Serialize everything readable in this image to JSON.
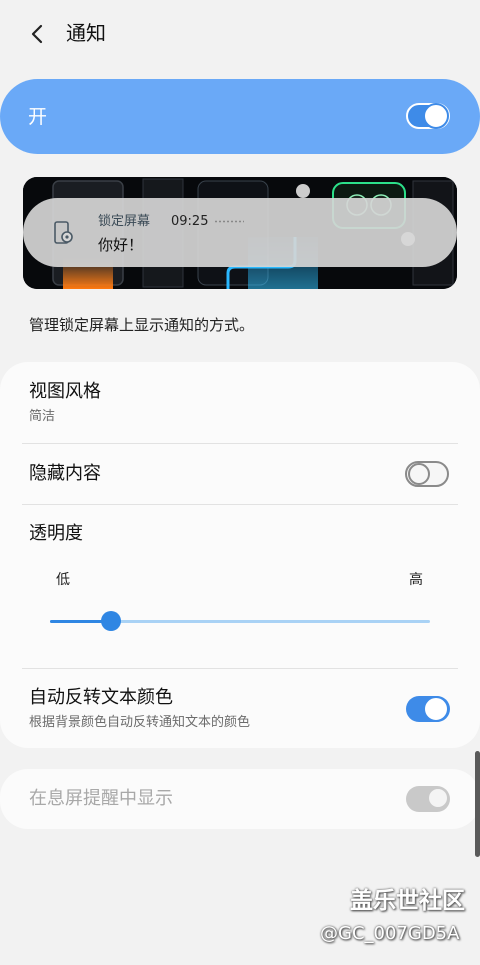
{
  "header": {
    "title": "通知",
    "back_icon": "chevron-left-icon"
  },
  "master": {
    "label": "开",
    "enabled": true
  },
  "preview": {
    "app_name": "锁定屏幕",
    "time": "09:25",
    "message": "你好！",
    "icon": "lockscreen-settings-icon"
  },
  "description": "管理锁定屏幕上显示通知的方式。",
  "settings": {
    "view_style": {
      "title": "视图风格",
      "value": "简洁"
    },
    "hide_content": {
      "title": "隐藏内容",
      "enabled": false
    },
    "transparency": {
      "title": "透明度",
      "low_label": "低",
      "high_label": "高",
      "value": 0.16
    },
    "auto_invert": {
      "title": "自动反转文本颜色",
      "subtitle": "根据背景颜色自动反转通知文本的颜色",
      "enabled": true
    },
    "aod": {
      "title": "在息屏提醒中显示",
      "enabled": true,
      "disabled": true
    }
  },
  "watermark": {
    "line1": "盖乐世社区",
    "line2": "@GC_007GD5A"
  },
  "colors": {
    "accent": "#3e8be8",
    "master_bg": "#6aa9f7",
    "background": "#f2f2f2"
  }
}
